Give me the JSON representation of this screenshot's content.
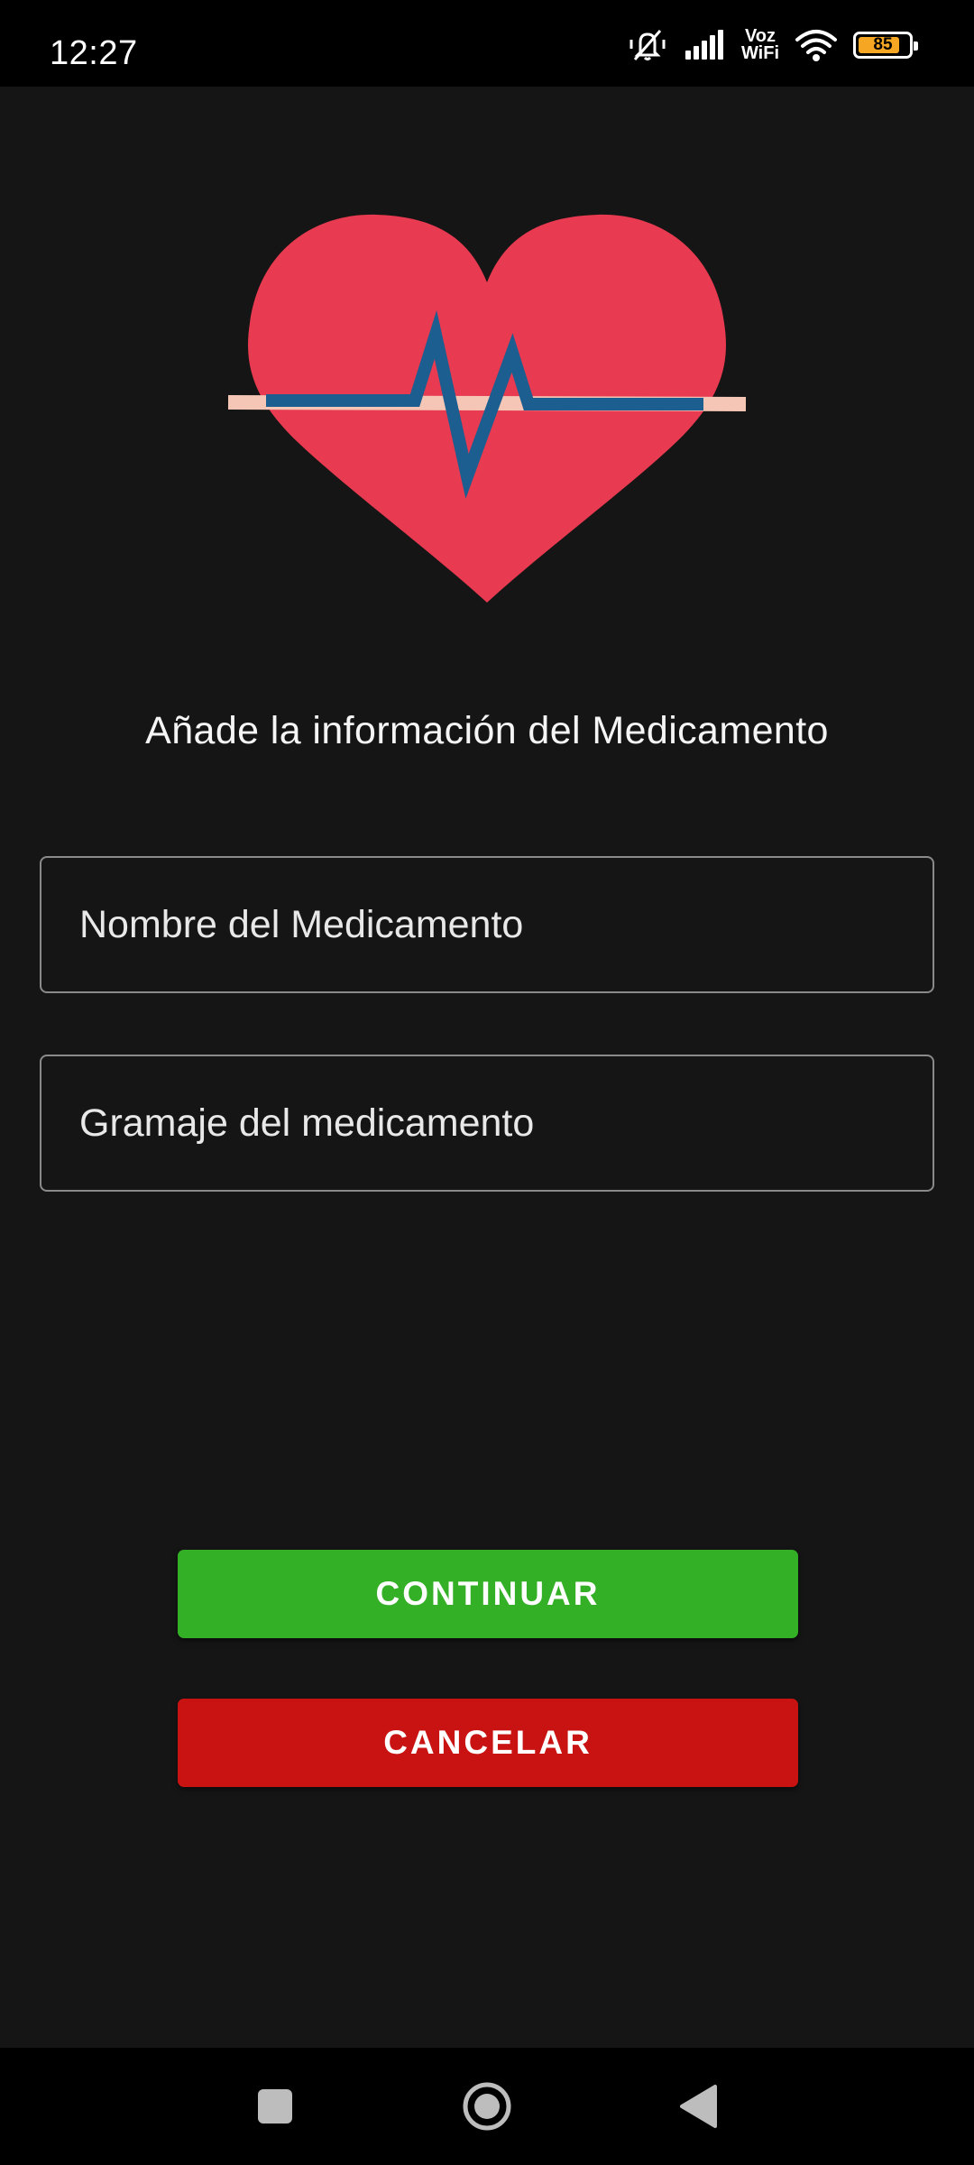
{
  "status_bar": {
    "time": "12:27",
    "voz_label": "Voz",
    "wifi_label": "WiFi",
    "battery_level": 85,
    "battery_text": "85",
    "icons": [
      "mute-icon",
      "signal-icon",
      "wifi-icon",
      "battery-icon"
    ]
  },
  "logo": {
    "icon": "heartbeat-icon",
    "colors": {
      "heart": "#E83A50",
      "pulse": "#1B5E8F",
      "line": "#F5C6B6"
    }
  },
  "form": {
    "title": "Añade la información del Medicamento",
    "name_field": {
      "placeholder": "Nombre del Medicamento",
      "value": ""
    },
    "dose_field": {
      "placeholder": "Gramaje del medicamento",
      "value": ""
    }
  },
  "actions": {
    "continue_label": "CONTINUAR",
    "cancel_label": "CANCELAR",
    "colors": {
      "continue": "#34B027",
      "cancel": "#C91313"
    }
  },
  "nav_bar": {
    "icons": [
      "recents-square-icon",
      "home-circle-icon",
      "back-triangle-icon"
    ]
  }
}
